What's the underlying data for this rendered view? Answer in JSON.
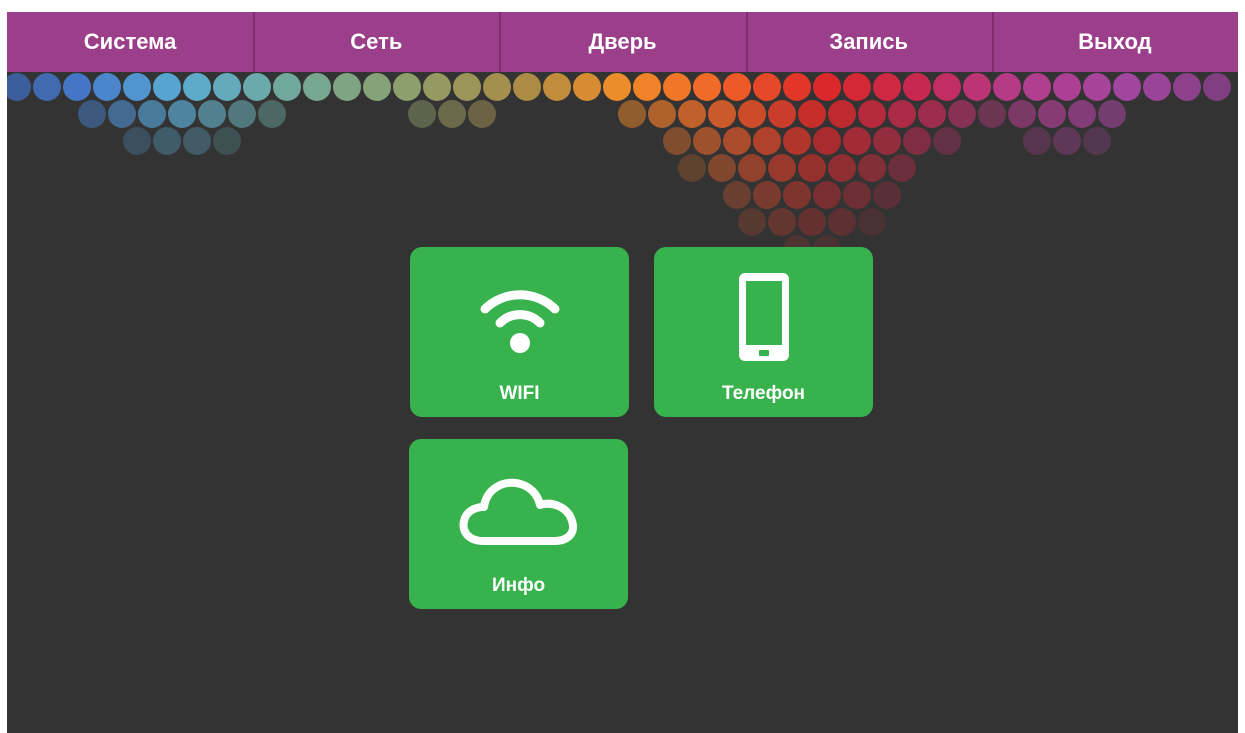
{
  "topbar": {
    "tabs": [
      {
        "label": "Система"
      },
      {
        "label": "Сеть"
      },
      {
        "label": "Дверь"
      },
      {
        "label": "Запись"
      },
      {
        "label": "Выход"
      }
    ]
  },
  "tiles": [
    {
      "label": "WIFI",
      "icon": "wifi-icon"
    },
    {
      "label": "Телефон",
      "icon": "phone-icon"
    },
    {
      "label": "Инфо",
      "icon": "cloud-icon"
    }
  ],
  "colors": {
    "background": "#333333",
    "topbar": "#9c3f8b",
    "tile": "#37b24d",
    "text": "#ffffff"
  }
}
